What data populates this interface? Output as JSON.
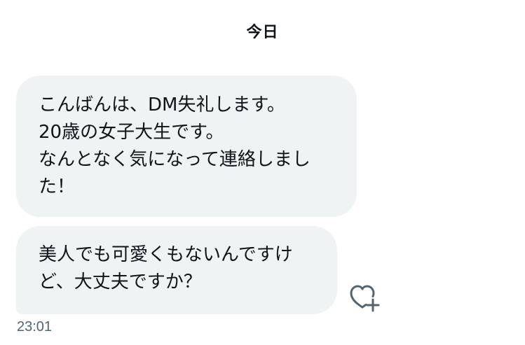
{
  "conversation": {
    "date_separator": "今日"
  },
  "messages": [
    {
      "lines": [
        "こんばんは、DM失礼します。",
        "20歳の女子大生です。",
        "なんとなく気になって連絡しまし",
        "た！"
      ]
    },
    {
      "lines": [
        "美人でも可愛くもないんですけ",
        "ど、大丈夫ですか？"
      ],
      "timestamp": "23:01"
    }
  ],
  "icons": {
    "react": "heart-plus-icon"
  },
  "colors": {
    "bubble_bg": "#eff3f4",
    "text": "#0f1419",
    "secondary_text": "#536471"
  }
}
